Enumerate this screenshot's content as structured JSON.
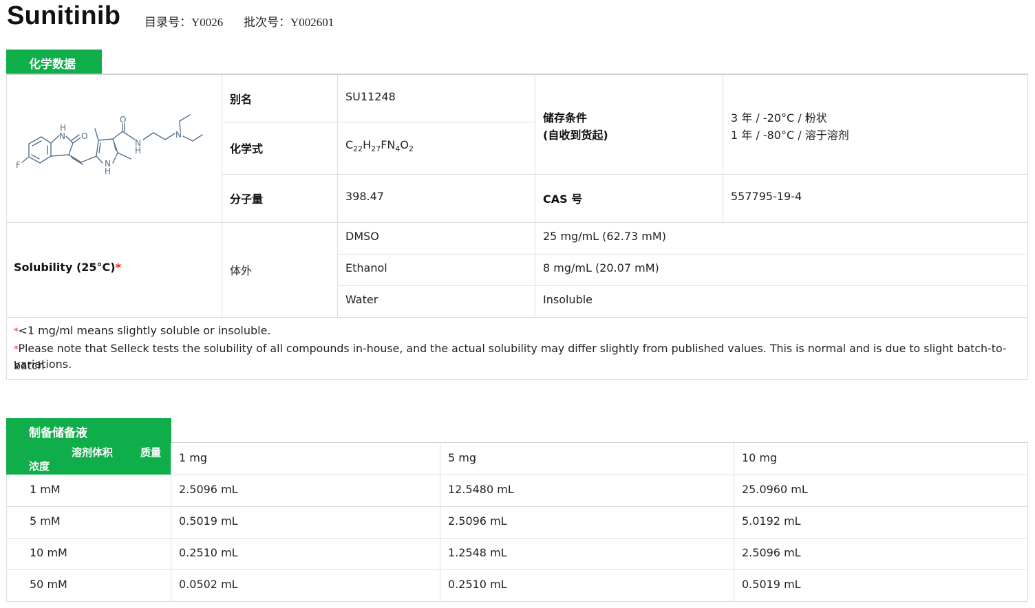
{
  "compound": {
    "name": "Sunitinib",
    "catalog_label": "目录号：",
    "catalog_value": "Y0026",
    "batch_label": "批次号：",
    "batch_value": "Y002601"
  },
  "chem_section": {
    "tab": "化学数据",
    "alias_label": "别名",
    "alias_value": "SU11248",
    "formula_label": "化学式",
    "formula": {
      "p1": "C",
      "s1": "22",
      "p2": "H",
      "s2": "27",
      "p3": "FN",
      "s3": "4",
      "p4": "O",
      "s4": "2"
    },
    "mw_label": "分子量",
    "mw_value": "398.47",
    "storage_label_1": "储存条件",
    "storage_label_2": "(自收到货起)",
    "storage_line_1": "3 年 / -20°C / 粉状",
    "storage_line_2": "1 年 / -80°C / 溶于溶剂",
    "cas_label": "CAS 号",
    "cas_value": "557795-19-4",
    "structure_atoms": {
      "f": "F",
      "nh_h": "H",
      "nh_n": "N",
      "o1": "O",
      "o2": "O",
      "pyr_n": "N",
      "pyr_h": "H",
      "amide_n": "N",
      "amide_h": "H",
      "amine_n": "N"
    }
  },
  "solubility": {
    "label": "Solubility (25°C)",
    "star": "*",
    "context": "体外",
    "rows": [
      {
        "solvent": "DMSO",
        "value": "25 mg/mL (62.73 mM)"
      },
      {
        "solvent": "Ethanol",
        "value": "8 mg/mL (20.07 mM)"
      },
      {
        "solvent": "Water",
        "value": "Insoluble"
      }
    ],
    "note_star": "*",
    "note_1": "<1 mg/ml means slightly soluble or insoluble.",
    "note_2a": "Please note that Selleck tests the solubility of all compounds in-house, and the actual solubility may differ slightly from published values. This is normal and is due to slight batch-to-batch",
    "note_2b": "variations."
  },
  "stock": {
    "tab": "制备储备液",
    "hdr_volume": "溶剂体积",
    "hdr_mass": "质量",
    "hdr_conc": "浓度",
    "masses": [
      "1 mg",
      "5 mg",
      "10 mg"
    ],
    "rows": [
      {
        "conc": "1 mM",
        "values": [
          "2.5096 mL",
          "12.5480 mL",
          "25.0960 mL"
        ]
      },
      {
        "conc": "5 mM",
        "values": [
          "0.5019 mL",
          "2.5096 mL",
          "5.0192 mL"
        ]
      },
      {
        "conc": "10 mM",
        "values": [
          "0.2510 mL",
          "1.2548 mL",
          "2.5096 mL"
        ]
      },
      {
        "conc": "50 mM",
        "values": [
          "0.0502 mL",
          "0.2510 mL",
          "0.5019 mL"
        ]
      }
    ]
  },
  "colors": {
    "brand_green": "#0fae4b",
    "star_red": "#e2231a",
    "structure_blue": "#55708a"
  }
}
